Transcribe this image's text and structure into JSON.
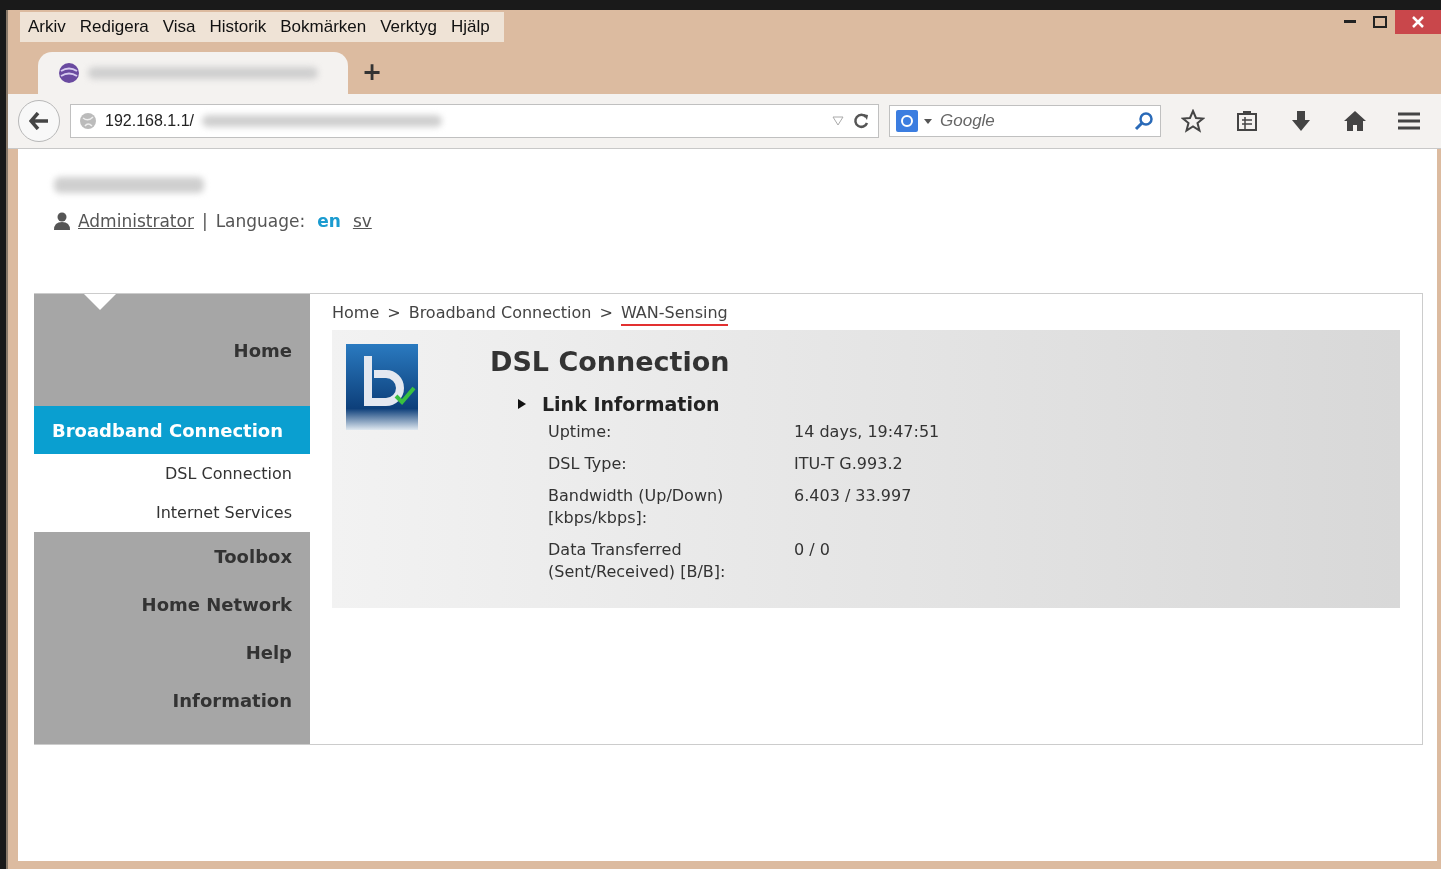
{
  "menu": [
    "Arkiv",
    "Redigera",
    "Visa",
    "Historik",
    "Bokmärken",
    "Verktyg",
    "Hjälp"
  ],
  "new_tab": "+",
  "address": {
    "value": "192.168.1.1/"
  },
  "search": {
    "placeholder": "Google"
  },
  "account": {
    "user": "Administrator",
    "separator": "|",
    "language_label": "Language:"
  },
  "languages": [
    {
      "label": "en",
      "selected": true
    },
    {
      "label": "sv",
      "selected": false
    }
  ],
  "nav": [
    {
      "label": "Home",
      "kind": "main",
      "selected": false
    },
    {
      "label": "Broadband Connection",
      "kind": "main",
      "selected": true
    },
    {
      "label": "DSL Connection",
      "kind": "sub",
      "selected": false
    },
    {
      "label": "Internet Services",
      "kind": "sub",
      "selected": false
    },
    {
      "label": "Toolbox",
      "kind": "main",
      "selected": false
    },
    {
      "label": "Home Network",
      "kind": "main",
      "selected": false
    },
    {
      "label": "Help",
      "kind": "main",
      "selected": false
    },
    {
      "label": "Information",
      "kind": "main",
      "selected": false
    }
  ],
  "breadcrumb": [
    {
      "label": "Home",
      "selected": false
    },
    {
      "label": "Broadband Connection",
      "selected": false
    },
    {
      "label": "WAN-Sensing",
      "selected": true
    }
  ],
  "breadcrumb_separator": ">",
  "panel": {
    "title": "DSL Connection",
    "section": "Link Information"
  },
  "rows": [
    {
      "label": "Uptime:",
      "value": "14 days, 19:47:51"
    },
    {
      "label": "DSL Type:",
      "value": "ITU-T G.993.2"
    },
    {
      "label": "Bandwidth (Up/Down) [kbps/kbps]:",
      "value": "6.403 / 33.997"
    },
    {
      "label": "Data Transferred (Sent/Received) [B/B]:",
      "value": "0 / 0"
    }
  ]
}
